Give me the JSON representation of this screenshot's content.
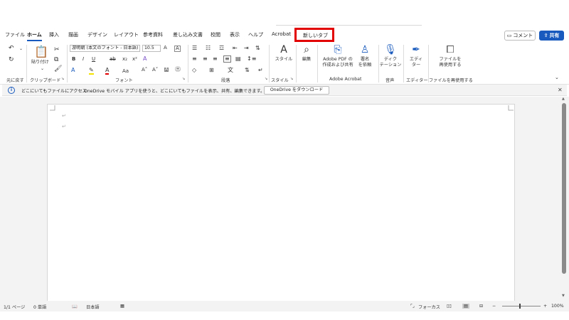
{
  "tabs": [
    {
      "label": "ファイル"
    },
    {
      "label": "ホーム"
    },
    {
      "label": "挿入"
    },
    {
      "label": "描画"
    },
    {
      "label": "デザイン"
    },
    {
      "label": "レイアウト"
    },
    {
      "label": "参考資料"
    },
    {
      "label": "差し込み文書"
    },
    {
      "label": "校閲"
    },
    {
      "label": "表示"
    },
    {
      "label": "ヘルプ"
    },
    {
      "label": "Acrobat"
    }
  ],
  "new_tab": {
    "label": "新しいタブ"
  },
  "header_buttons": {
    "comment": "コメント",
    "share": "共有"
  },
  "ribbon": {
    "undo_group": "元に戻す",
    "clipboard": {
      "paste": "貼り付け",
      "label": "クリップボード"
    },
    "font": {
      "name": "游明朝 (本文のフォント - 日本語)",
      "size": "10.5",
      "label": "フォント",
      "aa": "Aa"
    },
    "paragraph": {
      "label": "段落"
    },
    "styles": {
      "button": "スタイル",
      "label": "スタイル"
    },
    "editing": {
      "button": "編集"
    },
    "acrobat": {
      "pdf_line1": "Adobe PDF の",
      "pdf_line2": "作成および共有",
      "sign_line1": "署名",
      "sign_line2": "を依頼",
      "label": "Adobe Acrobat"
    },
    "voice": {
      "line1": "ディク",
      "line2": "テーション",
      "label": "音声"
    },
    "editor": {
      "line1": "エディ",
      "line2": "ター",
      "label": "エディター"
    },
    "reuse": {
      "line1": "ファイルを",
      "line2": "再使用する",
      "label": "ファイルを再使用する"
    }
  },
  "infobar": {
    "title": "どこにいてもファイルにアクセス",
    "message": "OneDrive モバイル アプリを使うと、どこにいてもファイルを表示、共有、編集できます。",
    "button": "OneDrive をダウンロード"
  },
  "status": {
    "page": "1/1 ページ",
    "words": "0 単語",
    "language": "日本語",
    "focus": "フォーカス",
    "zoom": "100%"
  },
  "colors": {
    "accent": "#185abd",
    "highlight_box": "#e30000"
  }
}
